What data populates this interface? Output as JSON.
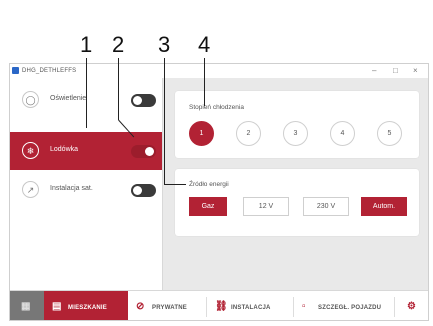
{
  "callouts": [
    "1",
    "2",
    "3",
    "4"
  ],
  "window": {
    "title": "DHG_DETHLEFFS",
    "controls": {
      "minimize": "–",
      "maximize": "□",
      "close": "×"
    }
  },
  "sidebar": {
    "items": [
      {
        "label": "Oświetlenie",
        "icon": "bulb-icon",
        "on": false
      },
      {
        "label": "Lodówka",
        "icon": "snowflake-icon",
        "on": true
      },
      {
        "label": "Instalacja sat.",
        "icon": "satellite-icon",
        "on": false
      }
    ]
  },
  "cooling": {
    "title": "Stopień chłodzenia",
    "levels": [
      "1",
      "2",
      "3",
      "4",
      "5"
    ],
    "selected": "1"
  },
  "energy": {
    "title": "Źródło energii",
    "options": [
      "Gaz",
      "12 V",
      "230 V",
      "Autom."
    ],
    "selected": [
      "Gaz",
      "Autom."
    ]
  },
  "tabs": [
    {
      "label": "",
      "icon": "grid-icon"
    },
    {
      "label": "MIESZKANIE",
      "icon": "living-icon"
    },
    {
      "label": "PRYWATNE",
      "icon": "private-icon"
    },
    {
      "label": "INSTALACJA",
      "icon": "installation-icon"
    },
    {
      "label": "SZCZEGŁ. POJAZDU",
      "icon": "vehicle-icon"
    },
    {
      "label": "",
      "icon": "gear-icon"
    }
  ],
  "colors": {
    "accent": "#b22234",
    "panel": "#e9e9e9",
    "toggle_off": "#3a3a3a"
  }
}
